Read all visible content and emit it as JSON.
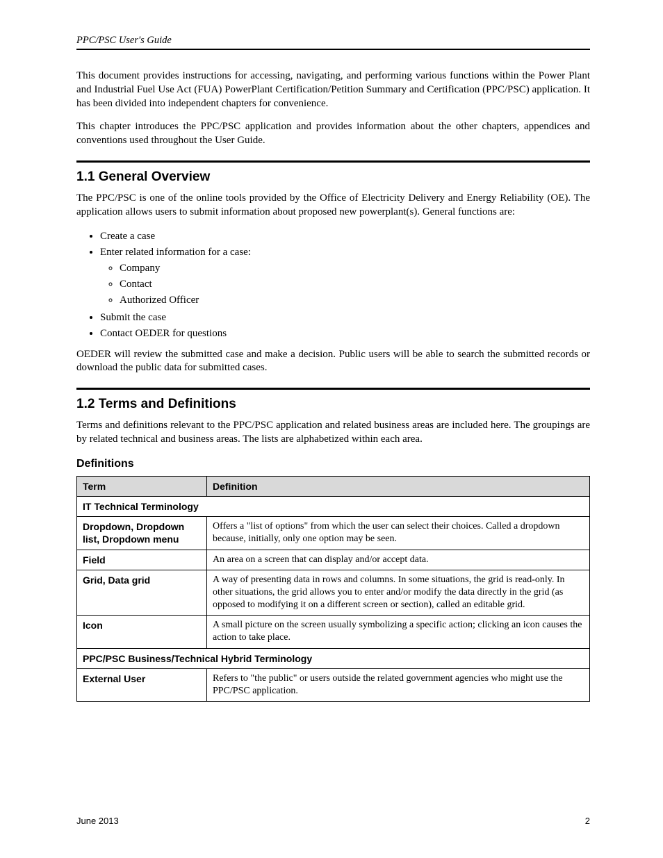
{
  "runningHead": "PPC/PSC User's Guide",
  "intro": {
    "p1": "This document provides instructions for accessing, navigating, and performing various functions within the Power Plant and Industrial Fuel Use Act (FUA) PowerPlant Certification/Petition Summary and Certification (PPC/PSC) application. It has been divided into independent chapters for convenience.",
    "p2": "This chapter introduces the PPC/PSC application and provides information about the other chapters, appendices and conventions used throughout the User Guide."
  },
  "sections": {
    "s11": {
      "title": "1.1 General Overview",
      "p1": "The PPC/PSC is one of the online tools provided by the Office of Electricity Delivery and Energy Reliability (OE). The application allows users to submit information about proposed new powerplant(s). General functions are:",
      "bullets": [
        "Create a case",
        "Enter related information for a case:",
        "Submit the case",
        "Contact OEDER for questions"
      ],
      "subbullets": [
        "Company",
        "Contact",
        "Authorized Officer"
      ],
      "p2": "OEDER will review the submitted case and make a decision. Public users will be able to search the submitted records or download the public data for submitted cases."
    },
    "s12": {
      "title": "1.2 Terms and Definitions",
      "p1": "Terms and definitions relevant to the PPC/PSC application and related business areas are included here. The groupings are by related technical and business areas. The lists are alphabetized within each area."
    }
  },
  "table": {
    "headers": {
      "term": "Term",
      "definition": "Definition"
    },
    "groups": [
      {
        "label": "IT Technical Terminology",
        "rows": [
          {
            "term": "Dropdown, Dropdown list, Dropdown menu",
            "definition": "Offers a \"list of options\" from which the user can select their choices. Called a dropdown because, initially, only one option may be seen."
          },
          {
            "term": "Field",
            "definition": "An area on a screen that can display and/or accept data."
          },
          {
            "term": "Grid, Data grid",
            "definition": "A way of presenting data in rows and columns. In some situations, the grid is read-only. In other situations, the grid allows you to enter and/or modify the data directly in the grid (as opposed to modifying it on a different screen or section), called an editable grid."
          },
          {
            "term": "Icon",
            "definition": "A small picture on the screen usually symbolizing a specific action; clicking an icon causes the action to take place."
          }
        ]
      },
      {
        "label": "PPC/PSC Business/Technical Hybrid Terminology",
        "rows": [
          {
            "term": "External User",
            "definition": "Refers to \"the public\" or users outside the related government agencies who might use the PPC/PSC application."
          }
        ]
      }
    ]
  },
  "footer": {
    "month": "June 2013",
    "page": "2"
  }
}
